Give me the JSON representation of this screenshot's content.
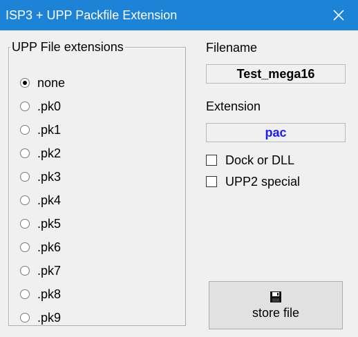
{
  "window": {
    "title": "ISP3 + UPP Packfile Extension",
    "close_icon": "close-icon"
  },
  "group": {
    "title": "UPP File extensions",
    "options": [
      {
        "label": "none",
        "checked": true
      },
      {
        "label": ".pk0",
        "checked": false
      },
      {
        "label": ".pk1",
        "checked": false
      },
      {
        "label": ".pk2",
        "checked": false
      },
      {
        "label": ".pk3",
        "checked": false
      },
      {
        "label": ".pk4",
        "checked": false
      },
      {
        "label": ".pk5",
        "checked": false
      },
      {
        "label": ".pk6",
        "checked": false
      },
      {
        "label": ".pk7",
        "checked": false
      },
      {
        "label": ".pk8",
        "checked": false
      },
      {
        "label": ".pk9",
        "checked": false
      }
    ]
  },
  "filename": {
    "label": "Filename",
    "value": "Test_mega16"
  },
  "extension": {
    "label": "Extension",
    "value": "pac",
    "value_color": "#1a1aff"
  },
  "checks": {
    "dock": {
      "label": "Dock or DLL",
      "checked": false
    },
    "upp2": {
      "label": "UPP2 special",
      "checked": false
    }
  },
  "store": {
    "label": "store file",
    "icon": "floppy-disk-icon"
  },
  "colors": {
    "titlebar": "#1c83d6",
    "window_bg": "#f0f0f0"
  }
}
